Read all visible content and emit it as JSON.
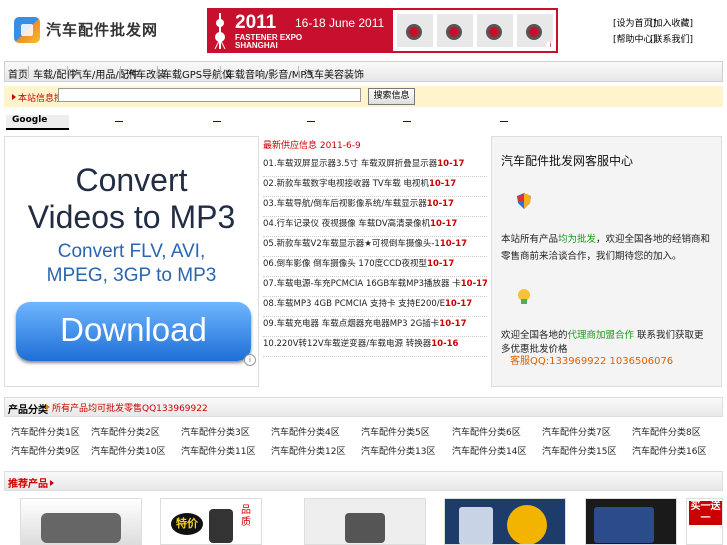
{
  "header": {
    "site_title": "汽车配件批发网",
    "top_links": [
      "[设为首页]",
      "[加入收藏]",
      "[帮助中心]",
      "[联系我们]"
    ]
  },
  "banner": {
    "year": "2011",
    "dates": "16-18 June 2011",
    "line1": "FASTENER EXPO",
    "line2": "SHANGHAI",
    "info_icon": "info-icon"
  },
  "nav": {
    "items": [
      "首页",
      "车载/配件",
      "汽车/用品/配件",
      "汽车改装",
      "车载GPS导航仪",
      "车载音响/影音/MP3",
      "汽车美容装饰"
    ]
  },
  "search": {
    "label": "本站信息搜索：",
    "placeholder": "",
    "button": "搜索信息"
  },
  "google": {
    "label": "Google"
  },
  "ad": {
    "line1": "Convert",
    "line2": "Videos to MP3",
    "line3": "Convert FLV, AVI,",
    "line4": "MPEG, 3GP to MP3",
    "button": "Download",
    "choice_icon": "adchoices-icon"
  },
  "news": {
    "heading": "最新供应信息 2011-6-9",
    "items": [
      {
        "text": "01.车载双屏显示器3.5寸 车载双屏折叠显示器",
        "date": "10-17"
      },
      {
        "text": "02.新款车载数字电视接收器 TV车载 电视机",
        "date": "10-17"
      },
      {
        "text": "03.车载导航/倒车后视影像系统/车载显示器",
        "date": "10-17"
      },
      {
        "text": "04.行车记录仪 夜视摄像 车载DV高清录像机",
        "date": "10-17"
      },
      {
        "text": "05.新款车载V2车载显示器★可视倒车摄像头-1",
        "date": "10-17"
      },
      {
        "text": "06.倒车影像 倒车摄像头 170度CCD夜视型",
        "date": "10-17"
      },
      {
        "text": "07.车载电源-车充PCMCIA 16GB车载MP3播放器 卡",
        "date": "10-17"
      },
      {
        "text": "08.车载MP3 4GB PCMCIA 支持卡 支持E200/E",
        "date": "10-17"
      },
      {
        "text": "09.车载充电器 车载点烟器充电器MP3 2G插卡",
        "date": "10-17"
      },
      {
        "text": "10.220V转12V车载逆变器/车载电源 转换器",
        "date": "10-16"
      }
    ]
  },
  "right_panel": {
    "title": "汽车配件批发网客服中心",
    "text1_a": "本站所有产品",
    "text1_b": "均为批发",
    "text1_c": "，欢迎全国各地的经销商和零售商前来洽谈合作，我们期待您的加入。",
    "text2_a": "欢迎全国各地的",
    "text2_b": "代理商加盟合作",
    "text2_c": " 联系我们获取更多优惠批发价格",
    "qq": "客服QQ:133969922 1036506076"
  },
  "categories": {
    "title": "产品分类",
    "note": "所有产品均可批发零售QQ133969922",
    "items": [
      "汽车配件分类1区",
      "汽车配件分类2区",
      "汽车配件分类3区",
      "汽车配件分类4区",
      "汽车配件分类5区",
      "汽车配件分类6区",
      "汽车配件分类7区",
      "汽车配件分类8区",
      "汽车配件分类9区",
      "汽车配件分类10区",
      "汽车配件分类11区",
      "汽车配件分类12区",
      "汽车配件分类13区",
      "汽车配件分类14区",
      "汽车配件分类15区",
      "汽车配件分类16区"
    ]
  },
  "products": {
    "title": "推荐产品",
    "labels": [
      "特价",
      "品质",
      "买一送一"
    ]
  }
}
